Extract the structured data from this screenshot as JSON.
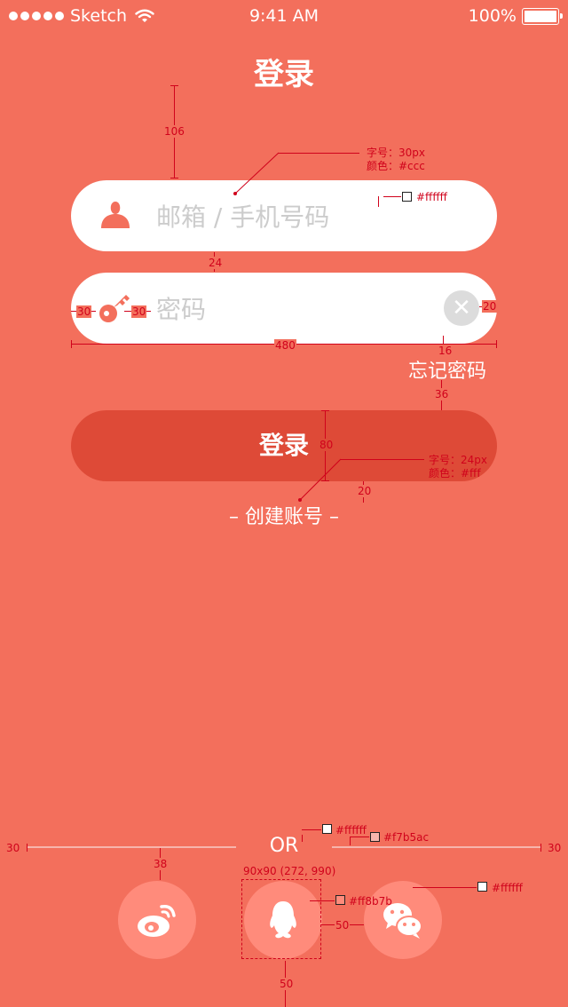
{
  "status_bar": {
    "carrier": "Sketch",
    "time": "9:41 AM",
    "battery": "100%",
    "signal_icon": "signal-dots-icon",
    "wifi_icon": "wifi-icon",
    "battery_icon": "battery-icon"
  },
  "header": {
    "title": "登录"
  },
  "login_form": {
    "account_placeholder": "邮箱 / 手机号码",
    "password_placeholder": "密码",
    "account_icon": "user-icon",
    "password_icon": "key-icon",
    "clear_icon": "clear-icon",
    "forgot_label": "忘记密码",
    "submit_label": "登录",
    "create_label": "– 创建账号 –"
  },
  "social": {
    "or_label": "OR",
    "items": [
      {
        "name": "weibo",
        "icon": "weibo-icon"
      },
      {
        "name": "qq",
        "icon": "qq-icon"
      },
      {
        "name": "wechat",
        "icon": "wechat-icon"
      }
    ]
  },
  "colors": {
    "background": "#f36f5c",
    "field_bg": "#ffffff",
    "placeholder": "#cccccc",
    "button_bg": "#de4a37",
    "divider": "#f7b5ac",
    "social_bg": "#ff8b7b",
    "annotation": "#d0021b"
  },
  "annotations": {
    "d106": "106",
    "d24": "24",
    "d30a": "30",
    "d30b": "30",
    "d20a": "20",
    "d480": "480",
    "d16": "16",
    "d36": "36",
    "d80": "80",
    "d20b": "20",
    "d30c": "30",
    "d30d": "30",
    "d38": "38",
    "d50a": "50",
    "d50b": "50",
    "font30": "字号：30px",
    "color_ccc": "颜色：#ccc",
    "font24": "字号：24px",
    "color_fff": "颜色：#fff",
    "hex_white_1": "#ffffff",
    "hex_white_2": "#ffffff",
    "hex_white_3": "#ffffff",
    "hex_divider": "#f7b5ac",
    "hex_social": "#ff8b7b",
    "size_pos": "90x90 (272, 990)"
  }
}
